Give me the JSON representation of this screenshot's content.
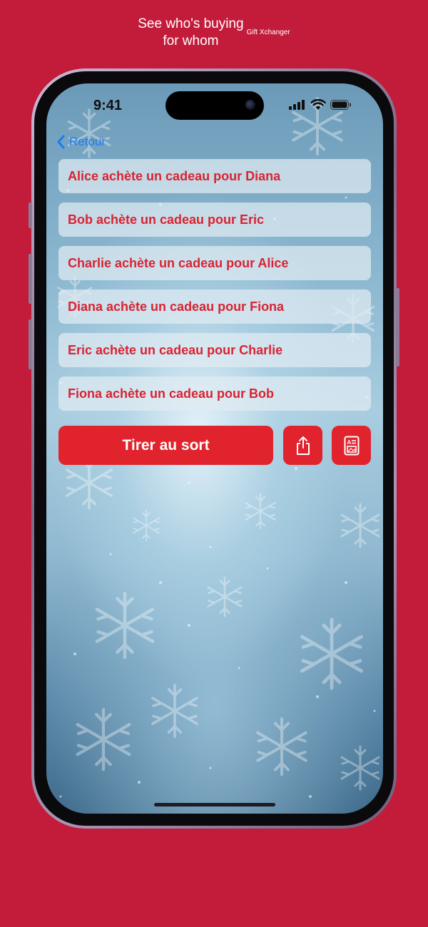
{
  "caption": {
    "line1": "See who's buying",
    "line2": "for whom",
    "app_name": "Gift Xchanger"
  },
  "status_bar": {
    "time": "9:41",
    "icons": [
      "cellular-signal-icon",
      "wifi-icon",
      "battery-icon"
    ]
  },
  "nav": {
    "back_label": "Retour"
  },
  "assignments": [
    {
      "text": "Alice achète un cadeau pour Diana"
    },
    {
      "text": "Bob achète un cadeau pour Eric"
    },
    {
      "text": "Charlie achète un cadeau pour Alice"
    },
    {
      "text": "Diana achète un cadeau pour Fiona"
    },
    {
      "text": "Eric achète un cadeau pour Charlie"
    },
    {
      "text": "Fiona achète un cadeau pour Bob"
    }
  ],
  "actions": {
    "draw_label": "Tirer au sort",
    "share_icon": "share-icon",
    "export_icon": "contact-card-icon"
  },
  "colors": {
    "background": "#c21c3a",
    "accent": "#e1232d",
    "row_text": "#d92332",
    "back_link": "#1e7bf0"
  }
}
